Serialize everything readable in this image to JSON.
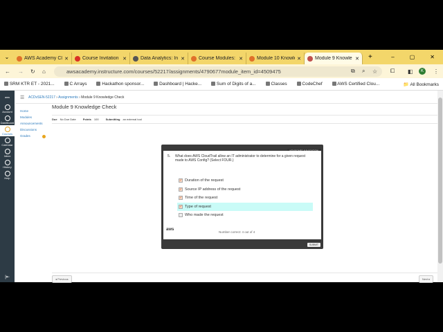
{
  "tabs": [
    {
      "label": "AWS Academy Cl",
      "color": "#e0702a"
    },
    {
      "label": "Course Invitation",
      "color": "#d93025"
    },
    {
      "label": "Data Analytics: In",
      "color": "#555555"
    },
    {
      "label": "Course Modules: /",
      "color": "#e0702a"
    },
    {
      "label": "Module 10 Knowle",
      "color": "#e0702a"
    },
    {
      "label": "Module 9 Knowle",
      "color": "#c0504d"
    }
  ],
  "url": "awsacademy.instructure.com/courses/52217/assignments/4790677module_item_id=4509475",
  "profile": "K",
  "bookmarks": [
    "SRM KTR ET - 2021...",
    "C Arrays",
    "Hackathon sponsor...",
    "Dashboard | Hacke...",
    "Sum of Digits of a...",
    "Classes",
    "CodeChef",
    "AWS Certified Clou..."
  ],
  "all_bookmarks": "All Bookmarks",
  "global_nav": [
    "Account",
    "Dashboard",
    "Courses",
    "Calendar",
    "Inbox",
    "History",
    "Help"
  ],
  "breadcrumb": {
    "course": "ACDvSEN-52217",
    "section": "Assignments",
    "page": "Module 9 Knowledge Check"
  },
  "course_nav": [
    "Home",
    "Modules",
    "Announcements",
    "Discussions",
    "Grades"
  ],
  "title": "Module 9 Knowledge Check",
  "meta": {
    "due_label": "Due",
    "due": "No Due Date",
    "points_label": "Points",
    "points": "100",
    "submitting_label": "Submitting",
    "submitting": "an external tool"
  },
  "quiz": {
    "keyboard_nav": "KEYBOARD NAVIGATION",
    "number": "5.",
    "question": "What does AWS CloudTrail allow an IT administrator to determine for a given request made to AWS Config? (Select FOUR.)",
    "options": [
      {
        "label": "Duration of the request",
        "checked": true
      },
      {
        "label": "Source IP address of the request",
        "checked": true
      },
      {
        "label": "Time of the request",
        "checked": true
      },
      {
        "label": "Type of request",
        "checked": true
      },
      {
        "label": "Who made the request",
        "checked": false
      }
    ],
    "logo": "aws",
    "score": "Number correct: 4 out of 4",
    "submit": "SUBMIT"
  },
  "previous": "◂ Previous",
  "next": "Next ▸"
}
